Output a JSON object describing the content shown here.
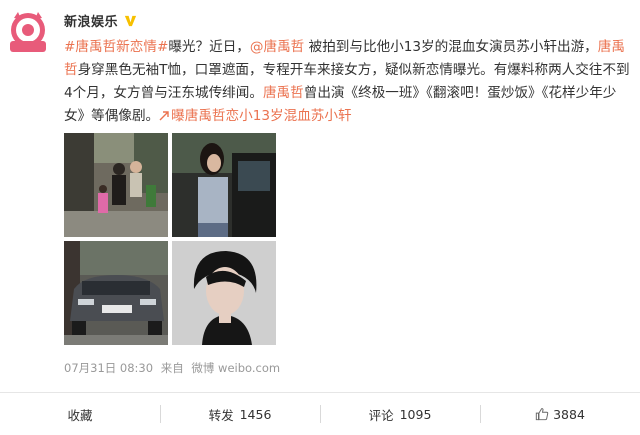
{
  "colors": {
    "accent": "#eb7350",
    "text": "#333333",
    "meta": "#999999",
    "verified": "#f7c000"
  },
  "author": {
    "avatar_text": "新浪娱乐",
    "name": "新浪娱乐",
    "verified_icon": "verified-badge-icon"
  },
  "post": {
    "segments": [
      {
        "text": "#唐禹哲新恋情#",
        "style": "hashtag"
      },
      {
        "text": "曝光？近日，",
        "style": "plain"
      },
      {
        "text": "@唐禹哲",
        "style": "mention"
      },
      {
        "text": " 被拍到与比他小13岁的混血女演员苏小轩出游，",
        "style": "plain"
      },
      {
        "text": "唐禹哲",
        "style": "mention"
      },
      {
        "text": "身穿黑色无袖T恤，口罩遮面，专程开车来接女方，疑似新恋情曝光。有爆料称两人交往不到4个月，女方曾与汪东城传绯闻。",
        "style": "plain"
      },
      {
        "text": "唐禹哲",
        "style": "mention"
      },
      {
        "text": "曾出演《终极一班》《翻滚吧！蛋炒饭》《花样少年少女》等偶像剧。",
        "style": "plain"
      },
      {
        "text": "曝唐禹哲恋小13岁混血苏小轩",
        "style": "link"
      }
    ]
  },
  "images": [
    {
      "name": "photo-street-couple"
    },
    {
      "name": "photo-woman-car"
    },
    {
      "name": "photo-porsche-suv"
    },
    {
      "name": "photo-tang-yuzhe-portrait"
    }
  ],
  "meta": {
    "date": "07月31日 08:30",
    "from_label": "来自",
    "source": "微博 weibo.com"
  },
  "actions": {
    "favorite": {
      "label": "收藏",
      "count": ""
    },
    "repost": {
      "label": "转发",
      "count": "1456"
    },
    "comment": {
      "label": "评论",
      "count": "1095"
    },
    "like": {
      "label": "",
      "count": "3884"
    }
  }
}
